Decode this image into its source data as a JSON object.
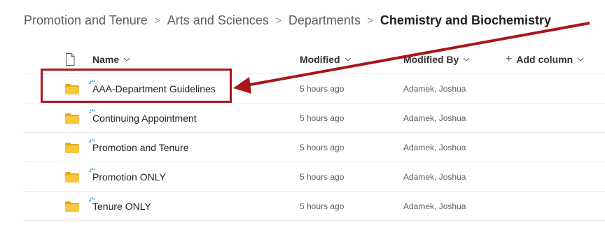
{
  "breadcrumb": {
    "items": [
      "Promotion and Tenure",
      "Arts and Sciences",
      "Departments"
    ],
    "current": "Chemistry and Biochemistry",
    "separator": ">"
  },
  "columns": {
    "name": "Name",
    "modified": "Modified",
    "modified_by": "Modified By",
    "add_column": "Add column",
    "add_symbol": "+"
  },
  "rows": [
    {
      "name": "AAA-Department Guidelines",
      "modified": "5 hours ago",
      "modified_by": "Adamek, Joshua"
    },
    {
      "name": "Continuing Appointment",
      "modified": "5 hours ago",
      "modified_by": "Adamek, Joshua"
    },
    {
      "name": "Promotion and Tenure",
      "modified": "5 hours ago",
      "modified_by": "Adamek, Joshua"
    },
    {
      "name": "Promotion ONLY",
      "modified": "5 hours ago",
      "modified_by": "Adamek, Joshua"
    },
    {
      "name": "Tenure ONLY",
      "modified": "5 hours ago",
      "modified_by": "Adamek, Joshua"
    }
  ],
  "colors": {
    "folder": "#f8c63f",
    "folder_tab": "#e8a918",
    "new_item_spark": "#2d8fc6",
    "annotation": "#a8161b"
  },
  "icons": {
    "file_type": "document-icon",
    "folder": "folder-icon",
    "new_item": "sparkle-icon",
    "chevron": "chevron-down-icon"
  },
  "annotation": {
    "type": "arrow-with-highlight-box",
    "target": "AAA-Department Guidelines"
  }
}
